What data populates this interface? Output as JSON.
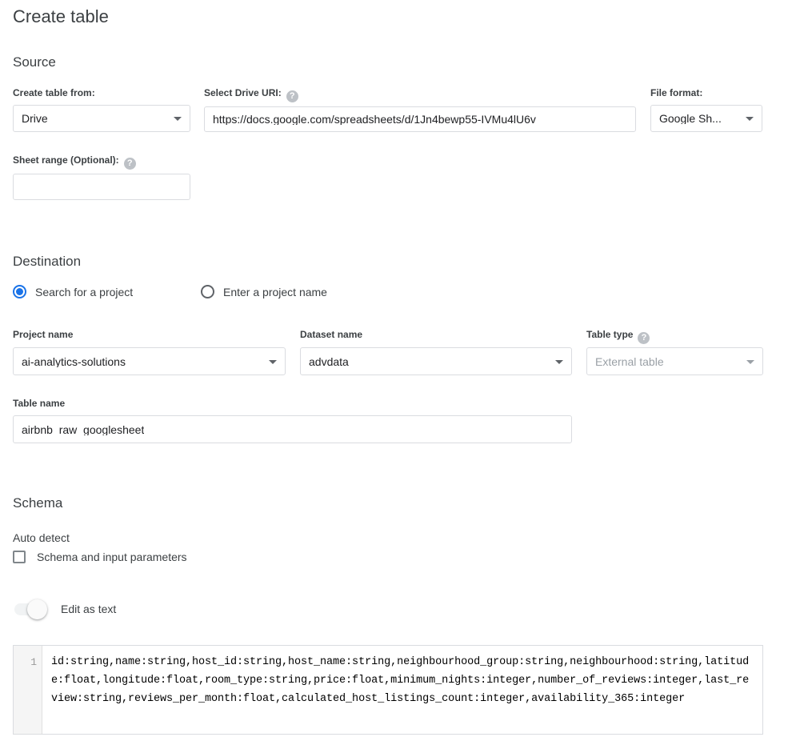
{
  "page": {
    "title": "Create table"
  },
  "source": {
    "section_title": "Source",
    "create_table_from": {
      "label": "Create table from:",
      "value": "Drive",
      "caret_icon": "chevron-down-icon"
    },
    "drive_uri": {
      "label": "Select Drive URI:",
      "help_icon": "help-icon",
      "help_glyph": "?",
      "value": "https://docs.google.com/spreadsheets/d/1Jn4bewp55-IVMu4lU6v"
    },
    "file_format": {
      "label": "File format:",
      "value": "Google Sh...",
      "caret_icon": "chevron-down-icon"
    },
    "sheet_range": {
      "label": "Sheet range (Optional):",
      "help_icon": "help-icon",
      "help_glyph": "?",
      "value": "",
      "placeholder": ""
    }
  },
  "destination": {
    "section_title": "Destination",
    "radios": [
      {
        "label": "Search for a project",
        "selected": true
      },
      {
        "label": "Enter a project name",
        "selected": false
      }
    ],
    "project_name": {
      "label": "Project name",
      "value": "ai-analytics-solutions",
      "caret_icon": "chevron-down-icon"
    },
    "dataset_name": {
      "label": "Dataset name",
      "value": "advdata",
      "caret_icon": "chevron-down-icon"
    },
    "table_type": {
      "label": "Table type",
      "help_icon": "help-icon",
      "help_glyph": "?",
      "value": "External table",
      "disabled": true,
      "caret_icon": "chevron-down-icon"
    },
    "table_name": {
      "label": "Table name",
      "value": "airbnb_raw_googlesheet"
    }
  },
  "schema": {
    "section_title": "Schema",
    "auto_detect_label": "Auto detect",
    "auto_detect_checkbox": {
      "label": "Schema and input parameters",
      "checked": false
    },
    "edit_as_text_toggle": {
      "label": "Edit as text",
      "on": true
    },
    "editor": {
      "line_number": "1",
      "text": "id:string,name:string,host_id:string,host_name:string,neighbourhood_group:string,neighbourhood:string,latitude:float,longitude:float,room_type:string,price:float,minimum_nights:integer,number_of_reviews:integer,last_review:string,reviews_per_month:float,calculated_host_listings_count:integer,availability_365:integer"
    }
  },
  "colors": {
    "accent": "#1a73e8",
    "text": "#3c4043",
    "muted": "#9aa0a6",
    "border": "#dadce0"
  }
}
